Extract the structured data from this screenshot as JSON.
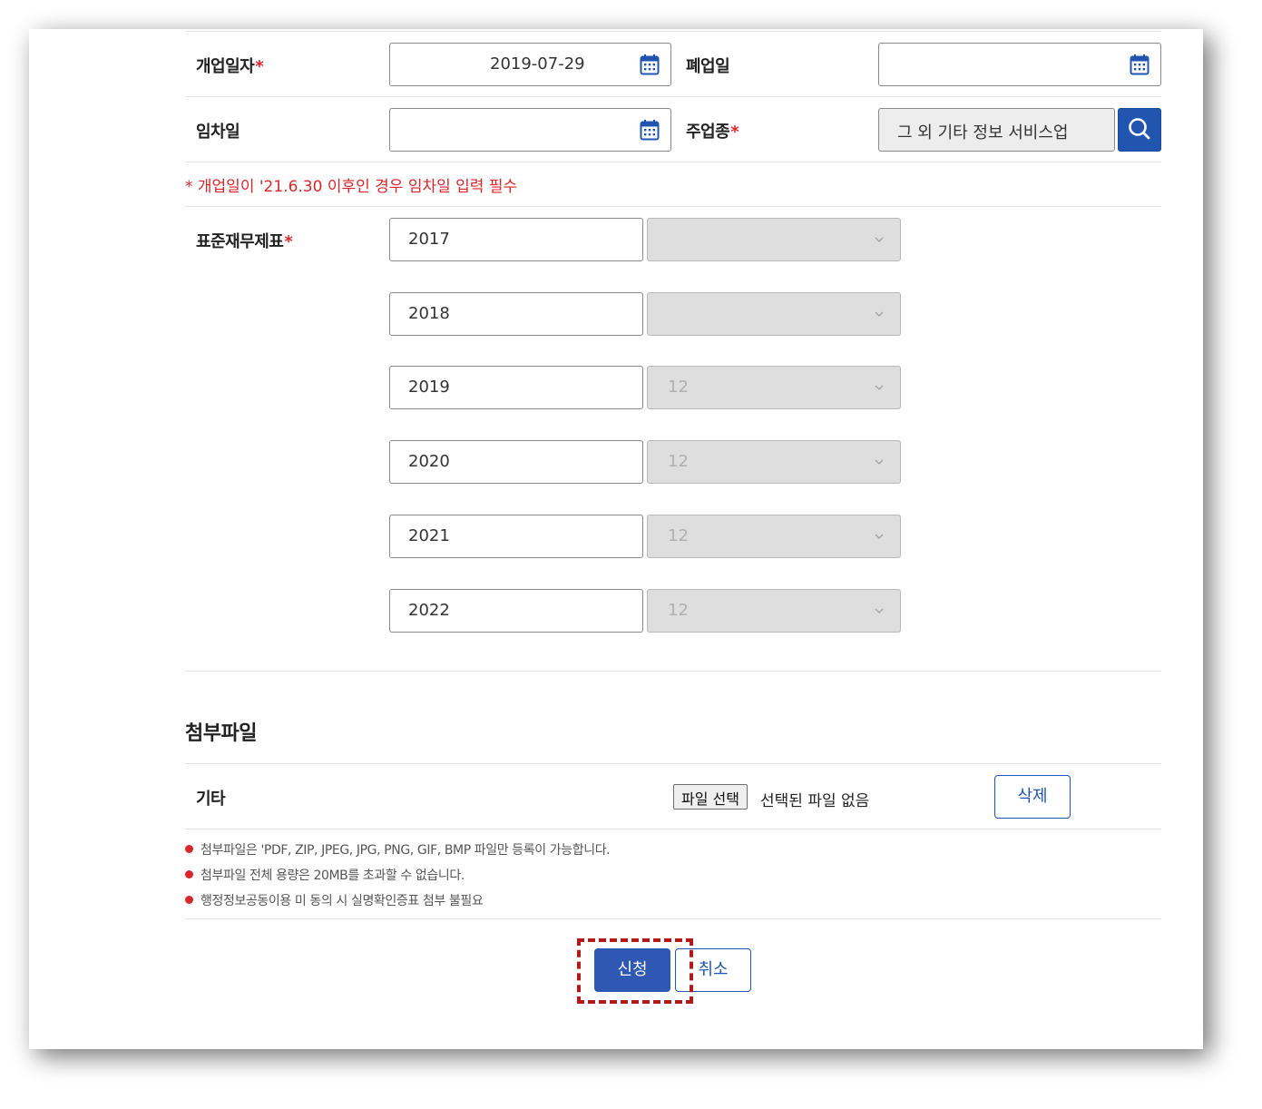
{
  "form": {
    "open_date": {
      "label": "개업일자",
      "required_mark": "*",
      "value": "2019-07-29"
    },
    "close_date": {
      "label": "폐업일",
      "value": ""
    },
    "lease_date": {
      "label": "임차일",
      "value": ""
    },
    "main_industry": {
      "label": "주업종",
      "required_mark": "*",
      "value": "그 외 기타 정보 서비스업"
    },
    "note": "* 개업일이 '21.6.30 이후인 경우 임차일 입력 필수",
    "financial": {
      "label": "표준재무제표",
      "required_mark": "*",
      "rows": [
        {
          "year": "2017",
          "month": ""
        },
        {
          "year": "2018",
          "month": ""
        },
        {
          "year": "2019",
          "month": "12"
        },
        {
          "year": "2020",
          "month": "12"
        },
        {
          "year": "2021",
          "month": "12"
        },
        {
          "year": "2022",
          "month": "12"
        }
      ]
    }
  },
  "attachments": {
    "title": "첨부파일",
    "row_label": "기타",
    "file_button": "파일 선택",
    "file_status": "선택된 파일 없음",
    "delete_button": "삭제",
    "notes": [
      "첨부파일은 'PDF, ZIP, JPEG, JPG, PNG, GIF, BMP 파일만 등록이 가능합니다.",
      "첨부파일 전체 용량은 20MB를 초과할 수 없습니다.",
      "행정정보공동이용 미 동의 시 실명확인증표 첨부 불필요"
    ]
  },
  "actions": {
    "submit": "신청",
    "cancel": "취소"
  },
  "colors": {
    "accent": "#2155b0",
    "required": "#d9262b",
    "highlight": "#b01a1a"
  },
  "icons": {
    "calendar": "calendar-icon",
    "search": "search-icon",
    "dropdown": "chevron-down-icon"
  }
}
